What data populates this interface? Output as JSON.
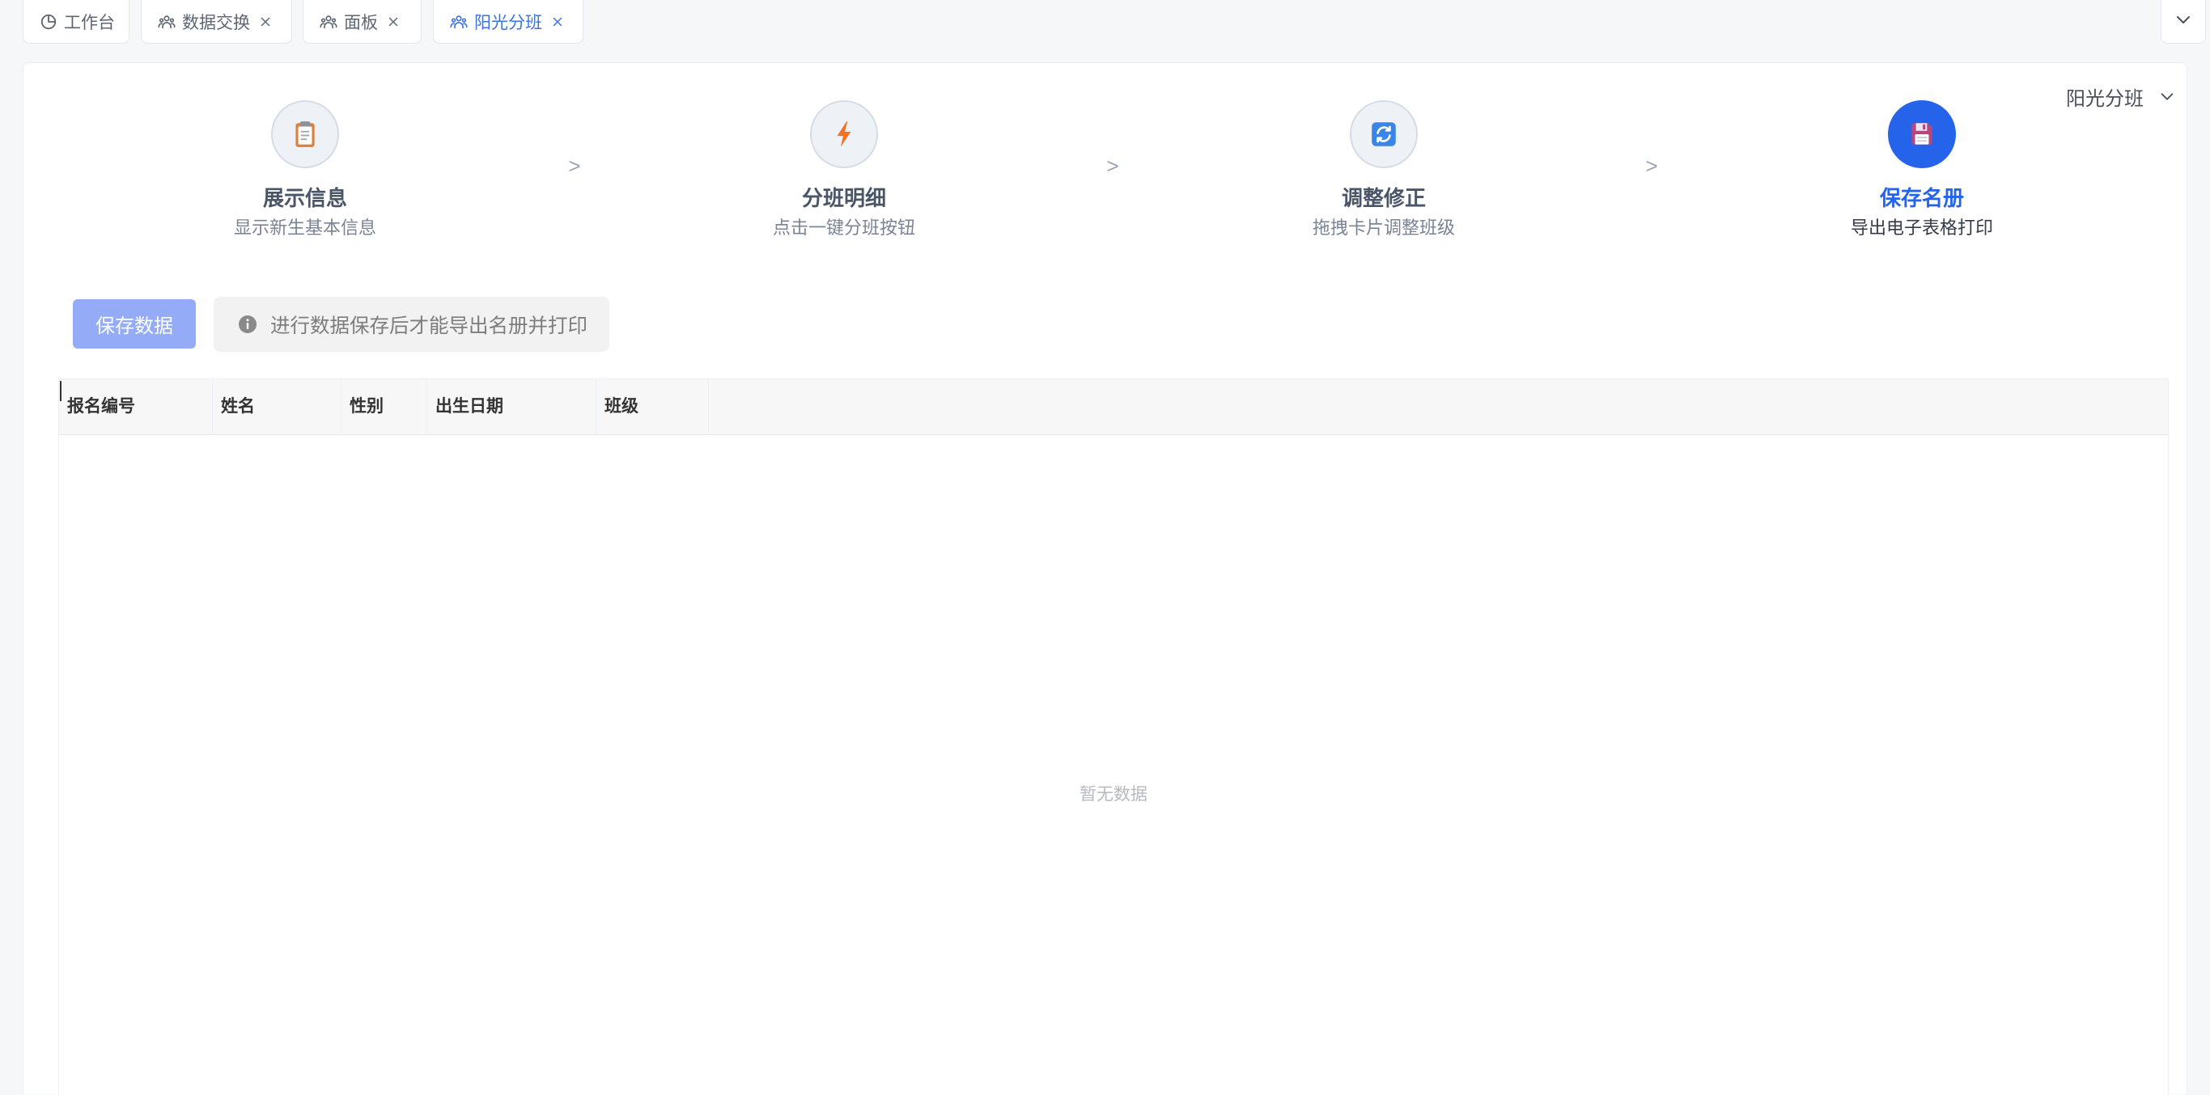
{
  "tabs": [
    {
      "label": "工作台",
      "icon": "pie-chart-icon",
      "closable": false,
      "active": false
    },
    {
      "label": "数据交换",
      "icon": "team-icon",
      "closable": true,
      "active": false
    },
    {
      "label": "面板",
      "icon": "team-icon",
      "closable": true,
      "active": false
    },
    {
      "label": "阳光分班",
      "icon": "team-icon",
      "closable": true,
      "active": true
    }
  ],
  "tabs_menu": {
    "icon": "chevron-down-icon"
  },
  "class_selector": {
    "value": "阳光分班",
    "icon": "chevron-down-icon"
  },
  "steps": [
    {
      "title": "展示信息",
      "description": "显示新生基本信息",
      "icon": "clipboard-icon",
      "active": false
    },
    {
      "title": "分班明细",
      "description": "点击一键分班按钮",
      "icon": "lightning-icon",
      "active": false
    },
    {
      "title": "调整修正",
      "description": "拖拽卡片调整班级",
      "icon": "refresh-icon",
      "active": false
    },
    {
      "title": "保存名册",
      "description": "导出电子表格打印",
      "icon": "save-icon",
      "active": true
    }
  ],
  "step_separator": ">",
  "toolbar": {
    "save_button_label": "保存数据",
    "save_button_disabled": true,
    "notice_icon": "info-icon",
    "notice_text": "进行数据保存后才能导出名册并打印"
  },
  "table": {
    "columns": [
      "报名编号",
      "姓名",
      "性别",
      "出生日期",
      "班级"
    ],
    "rows": [],
    "empty_text": "暂无数据"
  },
  "colors": {
    "accent": "#2563eb",
    "active_tab": "#3f72e0",
    "save_button_disabled": "#94acf8",
    "page_background": "#f6f7f9"
  }
}
